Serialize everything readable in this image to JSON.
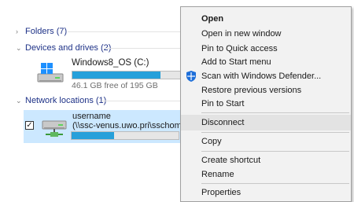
{
  "explorer": {
    "groups": {
      "folders": {
        "label": "Folders (7)",
        "chevron": "chevron-right-icon"
      },
      "devices": {
        "label": "Devices and drives (2)",
        "chevron": "chevron-down-icon"
      },
      "network": {
        "label": "Network locations (1)",
        "chevron": "chevron-down-icon"
      }
    },
    "drive": {
      "name": "Windows8_OS (C:)",
      "free_text": "46.1 GB free of 195 GB",
      "used_fraction": 0.76,
      "accent": "#26a0da"
    },
    "network_item": {
      "name": "username",
      "path": "(\\\\ssc-venus.uwo.pri\\sschome...",
      "used_fraction": 0.4,
      "checked_glyph": "✓",
      "selected_bg": "#cce8ff"
    }
  },
  "context_menu": {
    "items": [
      {
        "id": "open",
        "label": "Open"
      },
      {
        "id": "open-new-window",
        "label": "Open in new window"
      },
      {
        "id": "pin-quick-access",
        "label": "Pin to Quick access"
      },
      {
        "id": "add-start-menu",
        "label": "Add to Start menu"
      },
      {
        "id": "scan-defender",
        "label": "Scan with Windows Defender..."
      },
      {
        "id": "restore-versions",
        "label": "Restore previous versions"
      },
      {
        "id": "pin-start",
        "label": "Pin to Start"
      },
      {
        "id": "disconnect",
        "label": "Disconnect"
      },
      {
        "id": "copy",
        "label": "Copy"
      },
      {
        "id": "create-shortcut",
        "label": "Create shortcut"
      },
      {
        "id": "rename",
        "label": "Rename"
      },
      {
        "id": "properties",
        "label": "Properties"
      }
    ]
  }
}
